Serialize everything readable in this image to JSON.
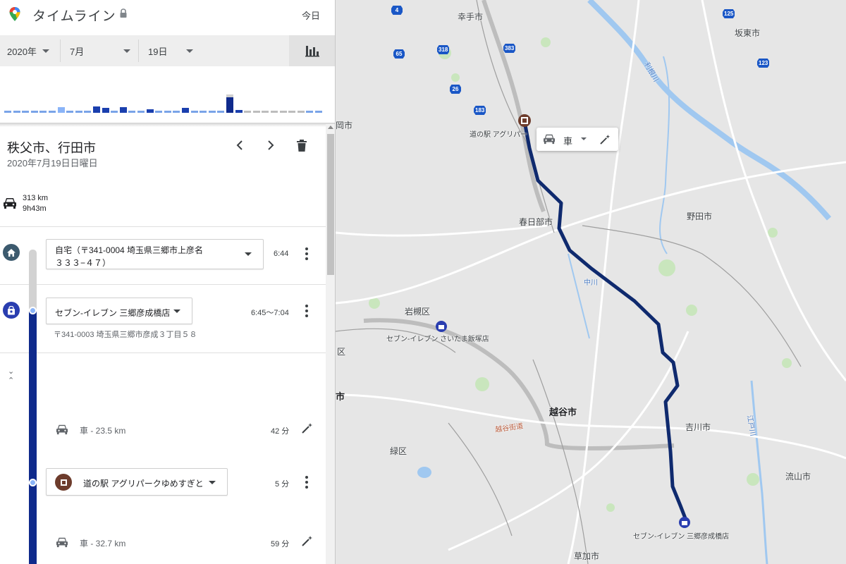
{
  "app": {
    "title": "タイムライン",
    "today_label": "今日",
    "logo_icon": "google-maps-pin-icon",
    "lock_icon": "lock-icon"
  },
  "date_picker": {
    "year": "2020年",
    "month": "7月",
    "day": "19日",
    "stats_icon": "bar-chart-icon"
  },
  "histogram": {
    "accent": "#1a3fae",
    "light": "#8ab4f8",
    "gray": "#bdbdbd",
    "selected_color": "#0f2a8c"
  },
  "day": {
    "title": "秩父市、行田市",
    "date": "2020年7月19日日曜日",
    "prev_icon": "chevron-left-icon",
    "next_icon": "chevron-right-icon",
    "delete_icon": "trash-icon"
  },
  "summary": {
    "icon": "car-icon",
    "distance": "313 km",
    "duration": "9h43m"
  },
  "timeline": {
    "rail_color": "#0f2a8c",
    "places": [
      {
        "name_line1": "自宅（〒341-0004 埼玉県三郷市上彦名",
        "name_line2": "３３３−４７）",
        "time": "6:44",
        "icon": "home-icon"
      },
      {
        "name": "セブン-イレブン 三郷彦成橋店",
        "time": "6:45〜7:04",
        "address": "〒341-0003 埼玉県三郷市彦成３丁目５８",
        "icon": "shopping-bag-icon"
      },
      {
        "name": "道の駅 アグリパークゆめすぎと",
        "time": "5 分",
        "icon": "stop-marker-icon"
      }
    ],
    "segments": [
      {
        "label": "車 - 23.5 km",
        "duration": "42 分"
      },
      {
        "label": "車 - 32.7 km",
        "duration": "59 分"
      }
    ],
    "expand_icon": "expand-chevrons-icon"
  },
  "map": {
    "route_color": "#0f2a6e",
    "mode_popup": {
      "label": "車",
      "icon": "car-icon",
      "edit_icon": "magic-wand-icon"
    },
    "cities": [
      {
        "name": "幸手市"
      },
      {
        "name": "坂東市"
      },
      {
        "name": "春日部市"
      },
      {
        "name": "野田市"
      },
      {
        "name": "岩槻区"
      },
      {
        "name": "越谷市"
      },
      {
        "name": "吉川市"
      },
      {
        "name": "流山市"
      },
      {
        "name": "緑区"
      },
      {
        "name": "草加市"
      },
      {
        "name": "道の駅 アグリパー"
      },
      {
        "name": "セブン-イレブン さいたま飯塚店"
      },
      {
        "name": "セブン-イレブン 三郷彦成橋店"
      },
      {
        "name": "中川"
      },
      {
        "name": "利根川"
      },
      {
        "name": "江戸川"
      },
      {
        "name": "越谷街道"
      },
      {
        "name": "岡市"
      },
      {
        "name": "区"
      },
      {
        "name": "市"
      }
    ],
    "routes": [
      {
        "num": "4"
      },
      {
        "num": "65"
      },
      {
        "num": "318"
      },
      {
        "num": "26"
      },
      {
        "num": "183"
      },
      {
        "num": "383"
      },
      {
        "num": "125"
      },
      {
        "num": "123"
      },
      {
        "name": ""
      }
    ]
  }
}
